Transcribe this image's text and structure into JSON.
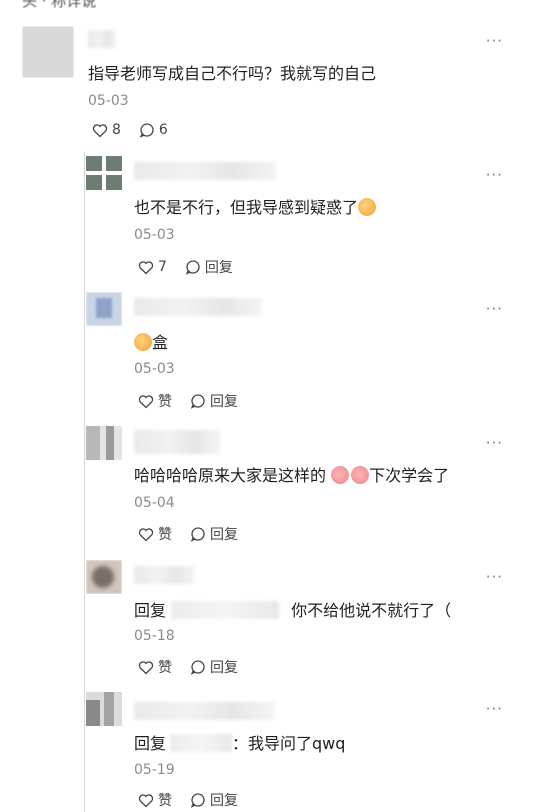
{
  "top_text": "头 · 称详说",
  "comments": [
    {
      "text_parts": [
        "指导老师写成自己不行吗？我就写的自己"
      ],
      "date": "05-03",
      "likes": "8",
      "replies": "6"
    },
    {
      "text_parts": [
        "也不是不行，但我导感到疑惑了"
      ],
      "date": "05-03",
      "likes": "7",
      "reply_label": "回复"
    },
    {
      "text_parts": [
        "盒"
      ],
      "date": "05-03",
      "like_label": "赞",
      "reply_label": "回复"
    },
    {
      "text_parts": [
        "哈哈哈哈原来大家是这样的 ",
        "下次学会了"
      ],
      "date": "05-04",
      "like_label": "赞",
      "reply_label": "回复"
    },
    {
      "text_parts": [
        "回复 ",
        "你不给他说不就行了（"
      ],
      "date": "05-18",
      "like_label": "赞",
      "reply_label": "回复"
    },
    {
      "text_parts": [
        "回复",
        "：我导问了qwq"
      ],
      "date": "05-19",
      "like_label": "赞",
      "reply_label": "回复"
    }
  ],
  "more_glyph": "···",
  "icons": {
    "like": "heart-outline-icon",
    "reply": "speech-bubble-icon",
    "more": "more-dots-icon"
  }
}
